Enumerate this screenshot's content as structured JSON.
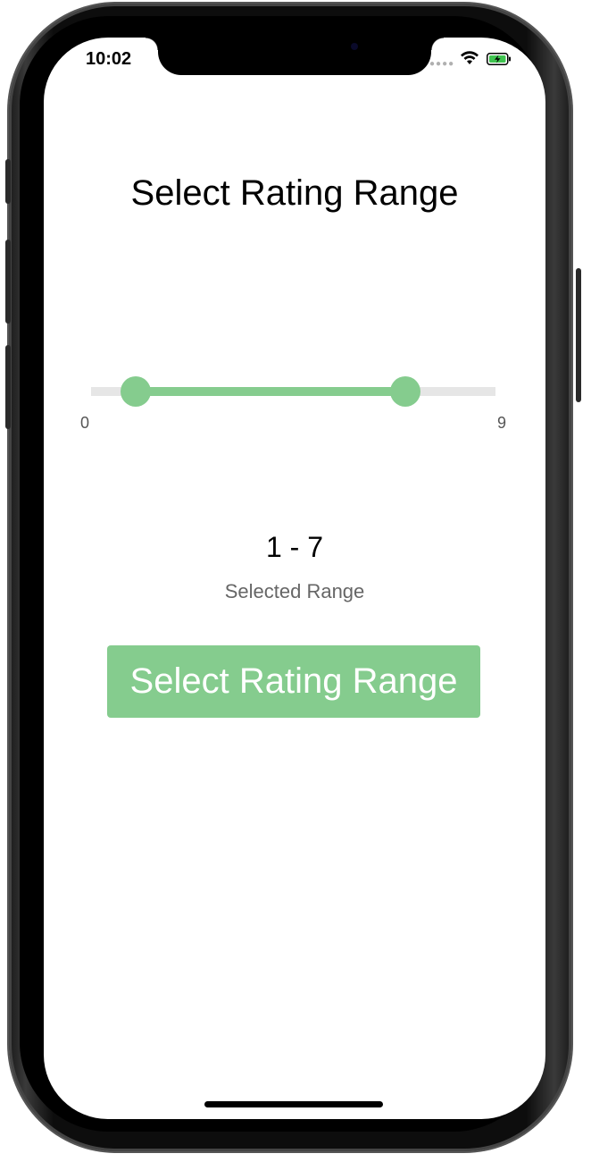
{
  "status_bar": {
    "time": "10:02",
    "signal_icon": "signal-dots-icon",
    "wifi_icon": "wifi-icon",
    "battery_icon": "battery-charging-icon"
  },
  "page": {
    "title": "Select Rating Range"
  },
  "slider": {
    "min": 0,
    "max": 9,
    "min_label": "0",
    "max_label": "9",
    "selected_low": 1,
    "selected_high": 7,
    "accent_color": "#85cc8e",
    "track_color": "#e6e6e6"
  },
  "selection": {
    "value": "1 - 7",
    "caption": "Selected Range"
  },
  "action": {
    "label": "Select Rating Range",
    "color": "#85cc8e"
  }
}
